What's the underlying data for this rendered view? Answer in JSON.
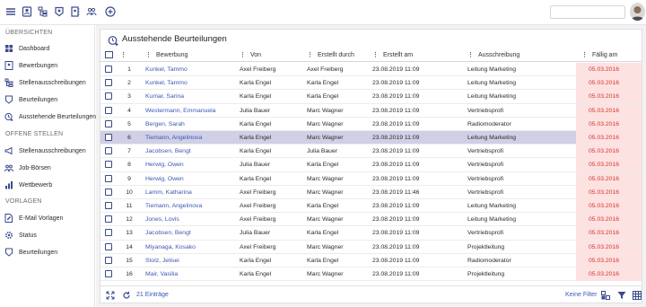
{
  "topbar": {
    "icons": [
      "menu-icon",
      "user-card-icon",
      "org-chart-icon",
      "badge-icon",
      "profile-book-icon",
      "people-icon",
      "add-circle-icon"
    ]
  },
  "sidebar": {
    "sec1": "ÜBERSICHTEN",
    "items1": [
      "Dashboard",
      "Bewerbungen",
      "Stellenausschreibungen",
      "Beurteilungen",
      "Ausstehende Beurteilungen"
    ],
    "sec2": "OFFENE STELLEN",
    "items2": [
      "Stellenausschreibungen",
      "Job-Börsen",
      "Wettbewerb"
    ],
    "sec3": "VORLAGEN",
    "items3": [
      "E-Mail Vorlagen",
      "Status",
      "Beurteilungen"
    ]
  },
  "panel": {
    "title": "Ausstehende Beurteilungen",
    "columns": [
      "Bewerbung",
      "Von",
      "Erstellt durch",
      "Erstellt am",
      "Ausschreibung",
      "Fällig am"
    ],
    "rows": [
      [
        "1",
        "Kunkel, Tammo",
        "Axel Freiberg",
        "Axel Freiberg",
        "23.08.2019 11:09",
        "Leitung Marketing",
        "05.03.2016"
      ],
      [
        "2",
        "Kunkel, Tammo",
        "Karla Engel",
        "Karla Engel",
        "23.08.2019 11:09",
        "Leitung Marketing",
        "05.03.2016"
      ],
      [
        "3",
        "Kumar, Sarina",
        "Karla Engel",
        "Karla Engel",
        "23.08.2019 11:09",
        "Leitung Marketing",
        "05.03.2016"
      ],
      [
        "4",
        "Westermann, Emmanuela",
        "Julia Bauer",
        "Marc Wagner",
        "23.08.2019 11:09",
        "Vertriebsprofi",
        "05.03.2016"
      ],
      [
        "5",
        "Bergen, Sarah",
        "Karla Engel",
        "Marc Wagner",
        "23.08.2019 11:09",
        "Radiomoderator",
        "05.03.2016"
      ],
      [
        "6",
        "Tiemann, Angelinova",
        "Karla Engel",
        "Marc Wagner",
        "23.08.2019 11:09",
        "Leitung Marketing",
        "05.03.2016"
      ],
      [
        "7",
        "Jacobsen, Bengt",
        "Karla Engel",
        "Julia Bauer",
        "23.08.2019 11:09",
        "Vertriebsprofi",
        "05.03.2016"
      ],
      [
        "8",
        "Herwig, Owen",
        "Julia Bauer",
        "Karla Engel",
        "23.08.2019 11:09",
        "Vertriebsprofi",
        "05.03.2016"
      ],
      [
        "9",
        "Herwig, Owen",
        "Karla Engel",
        "Marc Wagner",
        "23.08.2019 11:09",
        "Vertriebsprofi",
        "05.03.2016"
      ],
      [
        "10",
        "Lamm, Katharina",
        "Axel Freiberg",
        "Marc Wagner",
        "23.08.2019 11:46",
        "Vertriebsprofi",
        "05.03.2016"
      ],
      [
        "11",
        "Tiemann, Angelinova",
        "Axel Freiberg",
        "Karla Engel",
        "23.08.2019 11:09",
        "Leitung Marketing",
        "05.03.2016"
      ],
      [
        "12",
        "Jones, Lovis",
        "Axel Freiberg",
        "Marc Wagner",
        "23.08.2019 11:09",
        "Leitung Marketing",
        "05.03.2016"
      ],
      [
        "13",
        "Jacobsen, Bengt",
        "Julia Bauer",
        "Karla Engel",
        "23.08.2019 11:09",
        "Vertriebsprofi",
        "05.03.2016"
      ],
      [
        "14",
        "Miyanaga, Kosako",
        "Axel Freiberg",
        "Marc Wagner",
        "23.08.2019 11:09",
        "Projektleitung",
        "05.03.2016"
      ],
      [
        "15",
        "Stolz, Jelisei",
        "Karla Engel",
        "Karla Engel",
        "23.08.2019 11:09",
        "Radiomoderator",
        "05.03.2016"
      ],
      [
        "16",
        "Mair, Vasilia",
        "Karla Engel",
        "Marc Wagner",
        "23.08.2019 11:09",
        "Projektleitung",
        "05.03.2016"
      ]
    ],
    "selected_row": 6,
    "footer": {
      "count": "21 Einträge",
      "filter": "Keine Filter"
    }
  },
  "colors": {
    "accent": "#3b4a8a",
    "link": "#3c57b5",
    "due_bg": "#fde2e2",
    "due_text": "#d9342b",
    "selected": "#cfcfe6"
  }
}
